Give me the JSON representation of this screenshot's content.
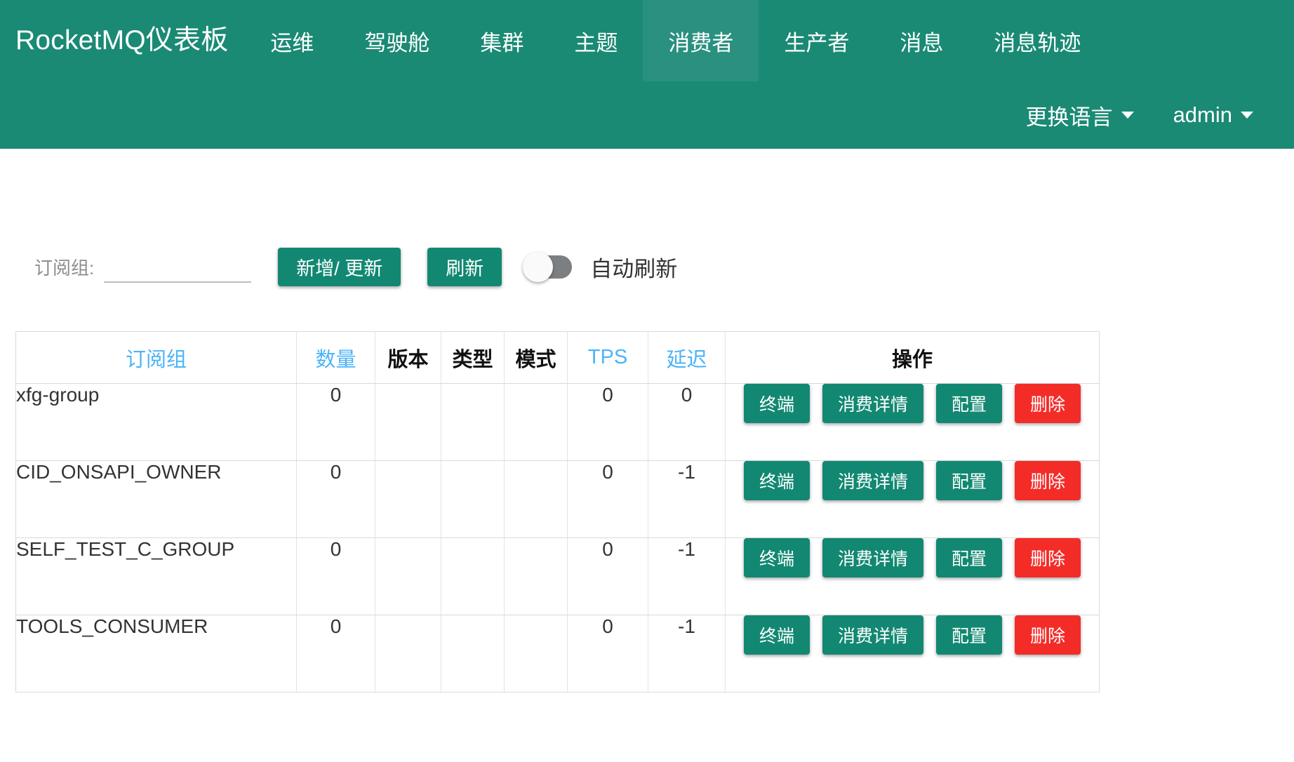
{
  "navbar": {
    "brand": "RocketMQ仪表板",
    "items": [
      {
        "label": "运维",
        "active": false
      },
      {
        "label": "驾驶舱",
        "active": false
      },
      {
        "label": "集群",
        "active": false
      },
      {
        "label": "主题",
        "active": false
      },
      {
        "label": "消费者",
        "active": true
      },
      {
        "label": "生产者",
        "active": false
      },
      {
        "label": "消息",
        "active": false
      },
      {
        "label": "消息轨迹",
        "active": false
      }
    ],
    "language_label": "更换语言",
    "user_label": "admin",
    "bg_color": "#1a8a74",
    "active_bg_color": "#2a9080"
  },
  "toolbar": {
    "subscription_label": "订阅组:",
    "subscription_value": "",
    "subscription_placeholder": "",
    "add_update_label": "新增/ 更新",
    "refresh_label": "刷新",
    "auto_refresh_label": "自动刷新",
    "auto_refresh_on": false
  },
  "table": {
    "columns": [
      {
        "label": "订阅组",
        "sortable": true
      },
      {
        "label": "数量",
        "sortable": true
      },
      {
        "label": "版本",
        "sortable": false
      },
      {
        "label": "类型",
        "sortable": false
      },
      {
        "label": "模式",
        "sortable": false
      },
      {
        "label": "TPS",
        "sortable": true
      },
      {
        "label": "延迟",
        "sortable": true
      },
      {
        "label": "操作",
        "sortable": false
      }
    ],
    "row_actions": [
      {
        "label": "终端",
        "style": "green"
      },
      {
        "label": "消费详情",
        "style": "green"
      },
      {
        "label": "配置",
        "style": "green"
      },
      {
        "label": "删除",
        "style": "red"
      }
    ],
    "rows": [
      {
        "name": "xfg-group",
        "qty": "0",
        "version": "",
        "type": "",
        "mode": "",
        "tps": "0",
        "delay": "0"
      },
      {
        "name": "CID_ONSAPI_OWNER",
        "qty": "0",
        "version": "",
        "type": "",
        "mode": "",
        "tps": "0",
        "delay": "-1"
      },
      {
        "name": "SELF_TEST_C_GROUP",
        "qty": "0",
        "version": "",
        "type": "",
        "mode": "",
        "tps": "0",
        "delay": "-1"
      },
      {
        "name": "TOOLS_CONSUMER",
        "qty": "0",
        "version": "",
        "type": "",
        "mode": "",
        "tps": "0",
        "delay": "-1"
      }
    ]
  },
  "colors": {
    "primary_green": "#128872",
    "danger_red": "#f32c28",
    "link_blue": "#4bb4f7"
  }
}
